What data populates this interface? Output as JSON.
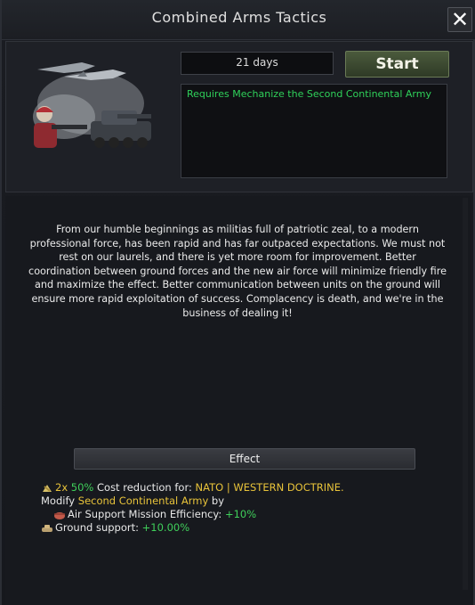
{
  "window": {
    "title": "Combined Arms Tactics",
    "close_label": "✕"
  },
  "header": {
    "days_label": "21 days",
    "start_label": "Start",
    "requirement_text": "Requires Mechanize the Second Continental Army"
  },
  "description": "From our humble beginnings as militias full of patriotic zeal, to a modern professional force, has been rapid and has far outpaced expectations. We must not rest on our laurels, and there is yet more room for improvement. Better coordination between ground forces and the new air force will minimize friendly fire and maximize the effect. Better communication between units on the ground will ensure more rapid exploitation of success. Complacency is death, and we're in the business of dealing it!",
  "effect": {
    "header_label": "Effect",
    "line1": {
      "multiplier": "2x",
      "percent": "50%",
      "text": "Cost reduction for:",
      "target": "NATO | WESTERN DOCTRINE."
    },
    "line2": {
      "prefix": "Modify",
      "army": "Second Continental Army",
      "suffix": "by"
    },
    "line3": {
      "label": "Air Support Mission Efficiency:",
      "value": "+10%"
    },
    "line4": {
      "label": "Ground support:",
      "value": "+10.00%"
    }
  },
  "colors": {
    "requirement_green": "#2fd15a",
    "highlight_yellow": "#e8c33a",
    "bonus_green": "#3fcf5a"
  },
  "icons": [
    "close-icon",
    "tactics-portrait",
    "cost-reduction-icon",
    "air-support-icon",
    "ground-support-icon"
  ]
}
